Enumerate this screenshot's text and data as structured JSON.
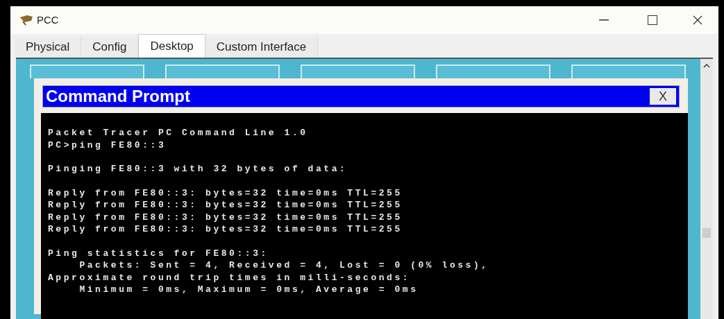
{
  "window": {
    "title": "PCC"
  },
  "tabs": [
    {
      "label": "Physical",
      "selected": false
    },
    {
      "label": "Config",
      "selected": false
    },
    {
      "label": "Desktop",
      "selected": true
    },
    {
      "label": "Custom Interface",
      "selected": false
    }
  ],
  "command_prompt": {
    "title": "Command Prompt",
    "close": "X",
    "blocks": [
      [
        "Packet Tracer PC Command Line 1.0",
        "PC>ping FE80::3"
      ],
      [
        "Pinging FE80::3 with 32 bytes of data:"
      ],
      [
        "Reply from FE80::3: bytes=32 time=0ms TTL=255",
        "Reply from FE80::3: bytes=32 time=0ms TTL=255",
        "Reply from FE80::3: bytes=32 time=0ms TTL=255",
        "Reply from FE80::3: bytes=32 time=0ms TTL=255"
      ],
      [
        "Ping statistics for FE80::3:",
        "    Packets: Sent = 4, Received = 4, Lost = 0 (0% loss),",
        "Approximate round trip times in milli-seconds:",
        "    Minimum = 0ms, Maximum = 0ms, Average = 0ms"
      ]
    ]
  }
}
